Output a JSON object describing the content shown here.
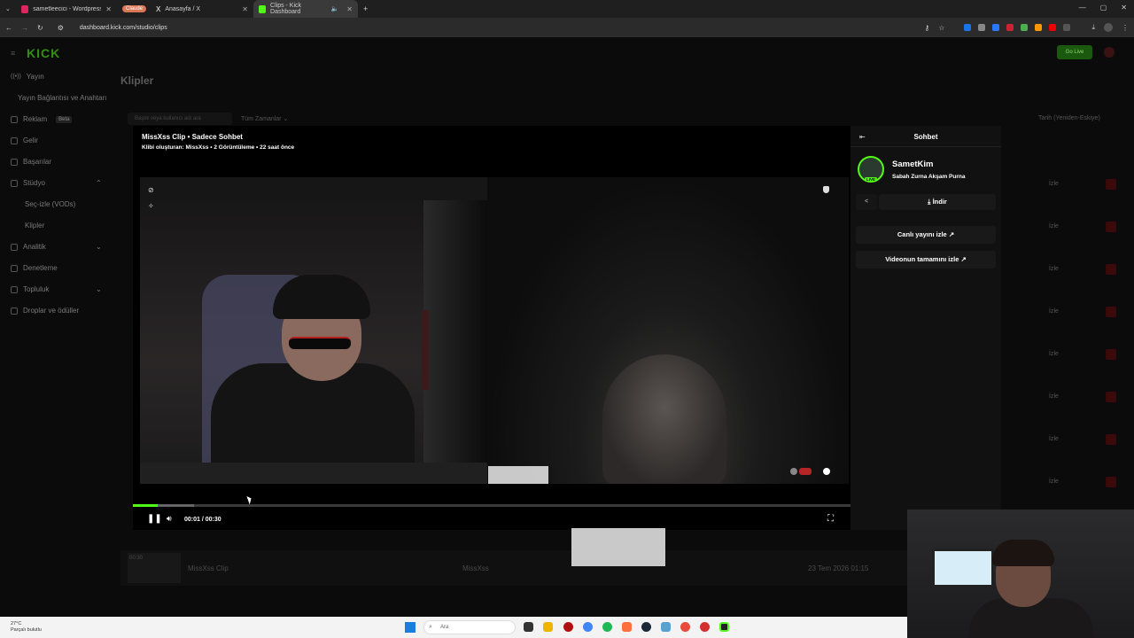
{
  "browser": {
    "tabs": [
      {
        "label": "sametleecici - Wordpress Uzmanı",
        "color": "#e0245e"
      },
      {
        "label": "Claude",
        "color": "#d97757"
      },
      {
        "label": "Anasayfa / X",
        "color": "#ffffff"
      },
      {
        "label": "Clips - Kick Dashboard",
        "color": "#53fc18"
      }
    ],
    "url": "dashboard.kick.com/studio/clips"
  },
  "sidebar": {
    "logo": "KICK",
    "items": [
      {
        "label": "Yayın"
      },
      {
        "label": "Yayın Bağlantısı ve Anahtarı"
      },
      {
        "label": "Reklam",
        "badge": "Beta"
      },
      {
        "label": "Gelir"
      },
      {
        "label": "Başarılar"
      },
      {
        "label": "Stüdyo"
      },
      {
        "label": "Seç-izle (VODs)"
      },
      {
        "label": "Klipler"
      },
      {
        "label": "Analitik"
      },
      {
        "label": "Denetleme"
      },
      {
        "label": "Topluluk"
      },
      {
        "label": "Droplar ve ödüller"
      }
    ]
  },
  "page": {
    "title": "Klipler",
    "search_placeholder": "Başlık veya kullanıcı adı ara",
    "filter_label": "Tüm Zamanlar",
    "sort_label": "Tarih (Yeniden-Eskiye)",
    "go_live": "Go Live",
    "row_action": "İzle",
    "bottom_row": {
      "duration": "00:30",
      "title": "MissXss Clip",
      "creator": "MissXss",
      "date": "23 Tem 2026 01:15"
    }
  },
  "modal": {
    "title": "MissXss Clip • Sadece Sohbet",
    "subtitle": "Klibi oluşturan: MissXss • 2 Görüntüleme • 22 saat önce",
    "player": {
      "current_time": "00:01 / 00:30",
      "progress": 0.035,
      "buffered": 0.085
    }
  },
  "chat": {
    "header": "Sohbet",
    "streamer_name": "SametKim",
    "stream_title": "Sabah Zurna Akşam Purna",
    "live_badge": "LIVE",
    "download_label": "İndir",
    "watch_live_label": "Canlı yayını izle",
    "watch_full_label": "Videonun tamamını izle"
  },
  "taskbar": {
    "temperature": "27°C",
    "weather": "Parçalı bulutlu",
    "search_label": "Ara"
  },
  "colors": {
    "accent": "#53fc18",
    "danger": "#3b0a0a"
  }
}
